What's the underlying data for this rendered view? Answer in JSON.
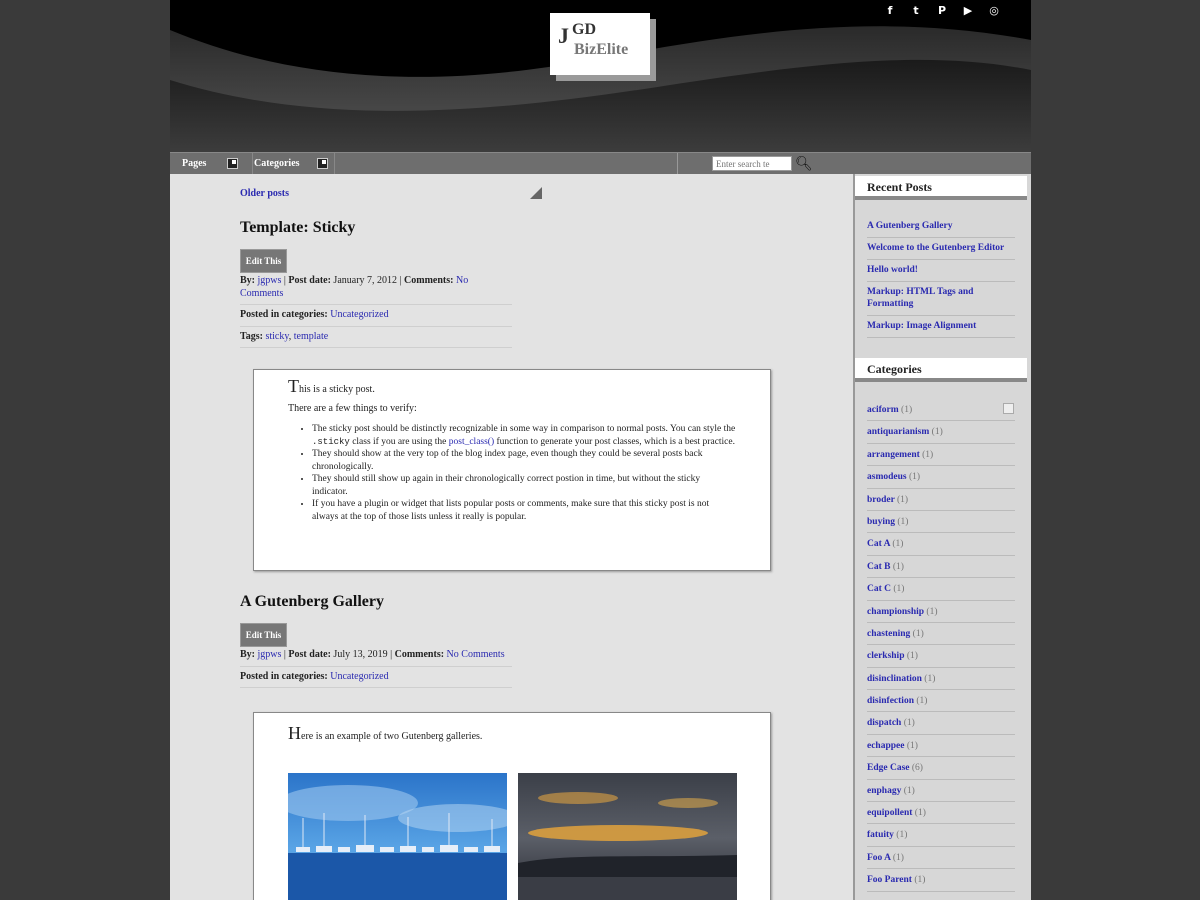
{
  "header": {
    "logo": {
      "initials": "JGD",
      "name": "BizElite",
      "j": "J"
    },
    "social": [
      {
        "name": "facebook-icon",
        "glyph": "f"
      },
      {
        "name": "twitter-icon",
        "glyph": "t"
      },
      {
        "name": "pinterest-icon",
        "glyph": "P"
      },
      {
        "name": "youtube-icon",
        "glyph": "▶"
      },
      {
        "name": "instagram-icon",
        "glyph": "◎"
      }
    ]
  },
  "nav": {
    "pages_label": "Pages",
    "categories_label": "Categories",
    "search_placeholder": "Enter search te"
  },
  "main": {
    "older_posts": "Older posts",
    "posts": [
      {
        "title": "Template: Sticky",
        "edit_label": "Edit This",
        "by_label": "By:",
        "author": "jgpws",
        "date_label": "Post date:",
        "date": "January 7, 2012",
        "comments_label": "Comments:",
        "comments": "No Comments",
        "categories_label": "Posted in categories:",
        "category": "Uncategorized",
        "tags_label": "Tags:",
        "tags": [
          "sticky",
          "template"
        ],
        "intro_drop": "T",
        "intro_rest": "his is a sticky post.",
        "subintro": "There are a few things to verify:",
        "bullets": [
          {
            "a": "The sticky post should be distinctly recognizable in some way in comparison to normal posts. You can style the ",
            "code": ".sticky",
            "b": " class if you are using the ",
            "link": "post_class()",
            "c": " function to generate your post classes, which is a best practice."
          },
          {
            "text": "They should show at the very top of the blog index page, even though they could be several posts back chronologically."
          },
          {
            "text": "They should still show up again in their chronologically correct postion in time, but without the sticky indicator."
          },
          {
            "text": "If you have a plugin or widget that lists popular posts or comments, make sure that this sticky post is not always at the top of those lists unless it really is popular."
          }
        ]
      },
      {
        "title": "A Gutenberg Gallery",
        "edit_label": "Edit This",
        "by_label": "By:",
        "author": "jgpws",
        "date_label": "Post date:",
        "date": "July 13, 2019",
        "comments_label": "Comments:",
        "comments": "No Comments",
        "categories_label": "Posted in categories:",
        "category": "Uncategorized",
        "intro_drop": "H",
        "intro_rest": "ere is an example of two Gutenberg galleries."
      }
    ]
  },
  "sidebar": {
    "recent_title": "Recent Posts",
    "recent": [
      "A Gutenberg Gallery",
      "Welcome to the Gutenberg Editor",
      "Hello world!",
      "Markup: HTML Tags and Formatting",
      "Markup: Image Alignment"
    ],
    "categories_title": "Categories",
    "categories": [
      {
        "name": "aciform",
        "count": "(1)"
      },
      {
        "name": "antiquarianism",
        "count": "(1)"
      },
      {
        "name": "arrangement",
        "count": "(1)"
      },
      {
        "name": "asmodeus",
        "count": "(1)"
      },
      {
        "name": "broder",
        "count": "(1)"
      },
      {
        "name": "buying",
        "count": "(1)"
      },
      {
        "name": "Cat A",
        "count": "(1)"
      },
      {
        "name": "Cat B",
        "count": "(1)"
      },
      {
        "name": "Cat C",
        "count": "(1)"
      },
      {
        "name": "championship",
        "count": "(1)"
      },
      {
        "name": "chastening",
        "count": "(1)"
      },
      {
        "name": "clerkship",
        "count": "(1)"
      },
      {
        "name": "disinclination",
        "count": "(1)"
      },
      {
        "name": "disinfection",
        "count": "(1)"
      },
      {
        "name": "dispatch",
        "count": "(1)"
      },
      {
        "name": "echappee",
        "count": "(1)"
      },
      {
        "name": "Edge Case",
        "count": "(6)"
      },
      {
        "name": "enphagy",
        "count": "(1)"
      },
      {
        "name": "equipollent",
        "count": "(1)"
      },
      {
        "name": "fatuity",
        "count": "(1)"
      },
      {
        "name": "Foo A",
        "count": "(1)"
      },
      {
        "name": "Foo Parent",
        "count": "(1)"
      }
    ]
  }
}
